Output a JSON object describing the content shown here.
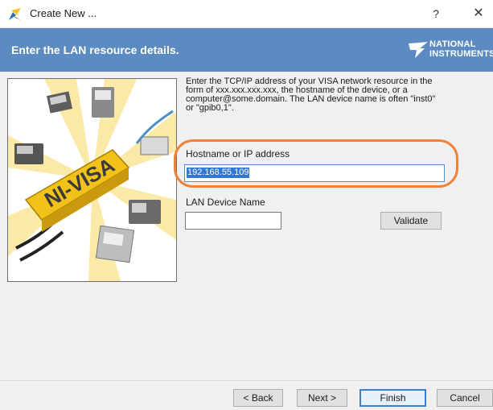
{
  "window": {
    "title": "Create New ...",
    "help_label": "?",
    "close_label": "✕"
  },
  "header": {
    "title": "Enter the LAN resource details.",
    "logo_line1": "NATIONAL",
    "logo_line2": "INSTRUMENTS"
  },
  "illustration": {
    "product_label": "NI-VISA"
  },
  "instructions": {
    "line1": "Enter the TCP/IP address of your VISA network resource in the",
    "line2": "form of xxx.xxx.xxx.xxx, the hostname of the device, or a",
    "line3": "computer@some.domain. The LAN device name is often \"inst0\"",
    "line4": "or \"gpib0,1\"."
  },
  "hostname": {
    "label": "Hostname or IP address",
    "value": "192.168.55.109"
  },
  "lan_device": {
    "label": "LAN Device Name",
    "value": ""
  },
  "buttons": {
    "validate": "Validate",
    "back": "< Back",
    "next": "Next >",
    "finish": "Finish",
    "cancel": "Cancel"
  },
  "colors": {
    "header_band": "#5b8bc0",
    "highlight_ring": "#f0813b",
    "selection": "#3377d4",
    "product_yellow": "#f2c21b"
  }
}
